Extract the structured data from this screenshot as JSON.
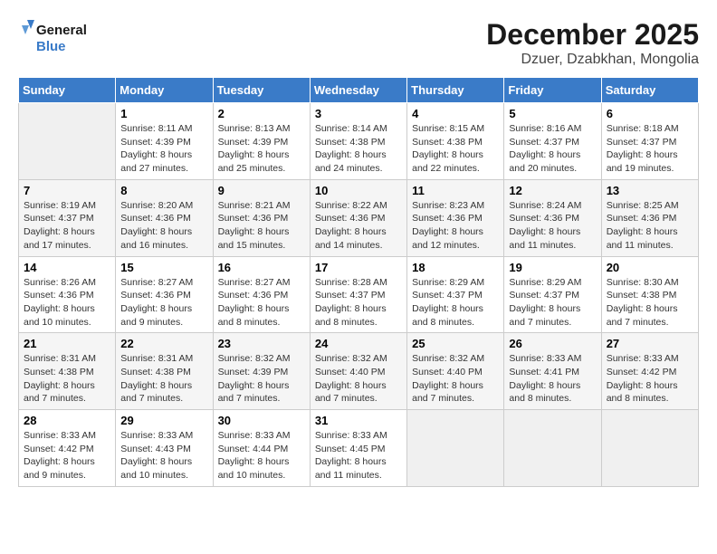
{
  "header": {
    "logo_line1": "General",
    "logo_line2": "Blue",
    "month": "December 2025",
    "location": "Dzuer, Dzabkhan, Mongolia"
  },
  "weekdays": [
    "Sunday",
    "Monday",
    "Tuesday",
    "Wednesday",
    "Thursday",
    "Friday",
    "Saturday"
  ],
  "weeks": [
    [
      {
        "day": "",
        "sunrise": "",
        "sunset": "",
        "daylight": ""
      },
      {
        "day": "1",
        "sunrise": "Sunrise: 8:11 AM",
        "sunset": "Sunset: 4:39 PM",
        "daylight": "Daylight: 8 hours and 27 minutes."
      },
      {
        "day": "2",
        "sunrise": "Sunrise: 8:13 AM",
        "sunset": "Sunset: 4:39 PM",
        "daylight": "Daylight: 8 hours and 25 minutes."
      },
      {
        "day": "3",
        "sunrise": "Sunrise: 8:14 AM",
        "sunset": "Sunset: 4:38 PM",
        "daylight": "Daylight: 8 hours and 24 minutes."
      },
      {
        "day": "4",
        "sunrise": "Sunrise: 8:15 AM",
        "sunset": "Sunset: 4:38 PM",
        "daylight": "Daylight: 8 hours and 22 minutes."
      },
      {
        "day": "5",
        "sunrise": "Sunrise: 8:16 AM",
        "sunset": "Sunset: 4:37 PM",
        "daylight": "Daylight: 8 hours and 20 minutes."
      },
      {
        "day": "6",
        "sunrise": "Sunrise: 8:18 AM",
        "sunset": "Sunset: 4:37 PM",
        "daylight": "Daylight: 8 hours and 19 minutes."
      }
    ],
    [
      {
        "day": "7",
        "sunrise": "Sunrise: 8:19 AM",
        "sunset": "Sunset: 4:37 PM",
        "daylight": "Daylight: 8 hours and 17 minutes."
      },
      {
        "day": "8",
        "sunrise": "Sunrise: 8:20 AM",
        "sunset": "Sunset: 4:36 PM",
        "daylight": "Daylight: 8 hours and 16 minutes."
      },
      {
        "day": "9",
        "sunrise": "Sunrise: 8:21 AM",
        "sunset": "Sunset: 4:36 PM",
        "daylight": "Daylight: 8 hours and 15 minutes."
      },
      {
        "day": "10",
        "sunrise": "Sunrise: 8:22 AM",
        "sunset": "Sunset: 4:36 PM",
        "daylight": "Daylight: 8 hours and 14 minutes."
      },
      {
        "day": "11",
        "sunrise": "Sunrise: 8:23 AM",
        "sunset": "Sunset: 4:36 PM",
        "daylight": "Daylight: 8 hours and 12 minutes."
      },
      {
        "day": "12",
        "sunrise": "Sunrise: 8:24 AM",
        "sunset": "Sunset: 4:36 PM",
        "daylight": "Daylight: 8 hours and 11 minutes."
      },
      {
        "day": "13",
        "sunrise": "Sunrise: 8:25 AM",
        "sunset": "Sunset: 4:36 PM",
        "daylight": "Daylight: 8 hours and 11 minutes."
      }
    ],
    [
      {
        "day": "14",
        "sunrise": "Sunrise: 8:26 AM",
        "sunset": "Sunset: 4:36 PM",
        "daylight": "Daylight: 8 hours and 10 minutes."
      },
      {
        "day": "15",
        "sunrise": "Sunrise: 8:27 AM",
        "sunset": "Sunset: 4:36 PM",
        "daylight": "Daylight: 8 hours and 9 minutes."
      },
      {
        "day": "16",
        "sunrise": "Sunrise: 8:27 AM",
        "sunset": "Sunset: 4:36 PM",
        "daylight": "Daylight: 8 hours and 8 minutes."
      },
      {
        "day": "17",
        "sunrise": "Sunrise: 8:28 AM",
        "sunset": "Sunset: 4:37 PM",
        "daylight": "Daylight: 8 hours and 8 minutes."
      },
      {
        "day": "18",
        "sunrise": "Sunrise: 8:29 AM",
        "sunset": "Sunset: 4:37 PM",
        "daylight": "Daylight: 8 hours and 8 minutes."
      },
      {
        "day": "19",
        "sunrise": "Sunrise: 8:29 AM",
        "sunset": "Sunset: 4:37 PM",
        "daylight": "Daylight: 8 hours and 7 minutes."
      },
      {
        "day": "20",
        "sunrise": "Sunrise: 8:30 AM",
        "sunset": "Sunset: 4:38 PM",
        "daylight": "Daylight: 8 hours and 7 minutes."
      }
    ],
    [
      {
        "day": "21",
        "sunrise": "Sunrise: 8:31 AM",
        "sunset": "Sunset: 4:38 PM",
        "daylight": "Daylight: 8 hours and 7 minutes."
      },
      {
        "day": "22",
        "sunrise": "Sunrise: 8:31 AM",
        "sunset": "Sunset: 4:38 PM",
        "daylight": "Daylight: 8 hours and 7 minutes."
      },
      {
        "day": "23",
        "sunrise": "Sunrise: 8:32 AM",
        "sunset": "Sunset: 4:39 PM",
        "daylight": "Daylight: 8 hours and 7 minutes."
      },
      {
        "day": "24",
        "sunrise": "Sunrise: 8:32 AM",
        "sunset": "Sunset: 4:40 PM",
        "daylight": "Daylight: 8 hours and 7 minutes."
      },
      {
        "day": "25",
        "sunrise": "Sunrise: 8:32 AM",
        "sunset": "Sunset: 4:40 PM",
        "daylight": "Daylight: 8 hours and 7 minutes."
      },
      {
        "day": "26",
        "sunrise": "Sunrise: 8:33 AM",
        "sunset": "Sunset: 4:41 PM",
        "daylight": "Daylight: 8 hours and 8 minutes."
      },
      {
        "day": "27",
        "sunrise": "Sunrise: 8:33 AM",
        "sunset": "Sunset: 4:42 PM",
        "daylight": "Daylight: 8 hours and 8 minutes."
      }
    ],
    [
      {
        "day": "28",
        "sunrise": "Sunrise: 8:33 AM",
        "sunset": "Sunset: 4:42 PM",
        "daylight": "Daylight: 8 hours and 9 minutes."
      },
      {
        "day": "29",
        "sunrise": "Sunrise: 8:33 AM",
        "sunset": "Sunset: 4:43 PM",
        "daylight": "Daylight: 8 hours and 10 minutes."
      },
      {
        "day": "30",
        "sunrise": "Sunrise: 8:33 AM",
        "sunset": "Sunset: 4:44 PM",
        "daylight": "Daylight: 8 hours and 10 minutes."
      },
      {
        "day": "31",
        "sunrise": "Sunrise: 8:33 AM",
        "sunset": "Sunset: 4:45 PM",
        "daylight": "Daylight: 8 hours and 11 minutes."
      },
      {
        "day": "",
        "sunrise": "",
        "sunset": "",
        "daylight": ""
      },
      {
        "day": "",
        "sunrise": "",
        "sunset": "",
        "daylight": ""
      },
      {
        "day": "",
        "sunrise": "",
        "sunset": "",
        "daylight": ""
      }
    ]
  ]
}
